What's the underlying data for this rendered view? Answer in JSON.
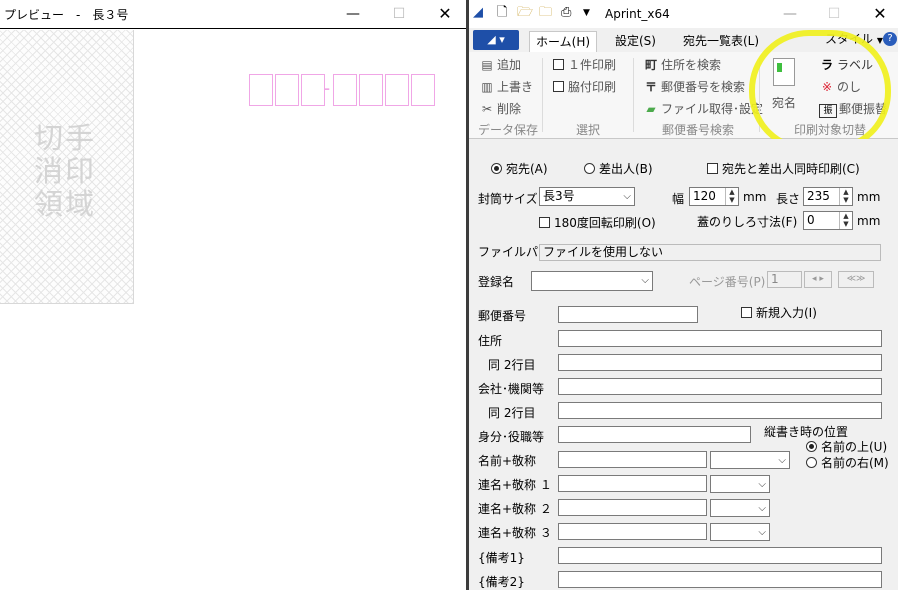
{
  "preview": {
    "title": "プレビュー　-　長３号",
    "stamp_lines": [
      "切手",
      "消印",
      "領域"
    ],
    "postal_dash": "-"
  },
  "app": {
    "name": "Aprint_x64",
    "tabs": [
      "ホーム(H)",
      "設定(S)",
      "宛先一覧表(L)"
    ],
    "style_label": "スタイル",
    "ribbon": {
      "data_group": {
        "add": "追加",
        "overwrite": "上書き",
        "delete": "削除",
        "label": "データ保存"
      },
      "select_group": {
        "one": "１件印刷",
        "side": "脇付印刷",
        "label": "選択"
      },
      "postal_group": {
        "addr": "住所を検索",
        "zip": "郵便番号を検索",
        "file": "ファイル取得･設定",
        "label": "郵便番号検索"
      },
      "target_group": {
        "big": "宛名",
        "label_btn": "ラベル",
        "noshi": "のし",
        "furikae": "郵便振替",
        "label": "印刷対象切替"
      }
    },
    "form": {
      "radio_dest": "宛先(A)",
      "radio_sender": "差出人(B)",
      "chk_both": "宛先と差出人同時印刷(C)",
      "envelope_label": "封筒サイズ",
      "envelope_value": "長3号",
      "width_label": "幅",
      "width_value": "120",
      "length_label": "長さ",
      "length_value": "235",
      "mm": "mm",
      "rotate": "180度回転印刷(O)",
      "flap_label": "蓋のりしろ寸法(F)",
      "flap_value": "0",
      "filepath_label": "ファイルパス",
      "filepath_value": "ファイルを使用しない",
      "regname_label": "登録名",
      "page_label": "ページ番号(P)",
      "page_value": "1",
      "zip_label": "郵便番号",
      "new_entry": "新規入力(I)",
      "address_label": "住所",
      "line2_label": "同 2行目",
      "company_label": "会社･機関等",
      "company_line2_label": "同 2行目",
      "title_label": "身分･役職等",
      "vertical_pos": "縦書き時の位置",
      "pos_above": "名前の上(U)",
      "pos_right": "名前の右(M)",
      "name_label": "名前+敬称",
      "joint1": "連名+敬称 １",
      "joint2": "連名+敬称 ２",
      "joint3": "連名+敬称 ３",
      "note1": "{備考1}",
      "note2": "{備考2}"
    }
  }
}
